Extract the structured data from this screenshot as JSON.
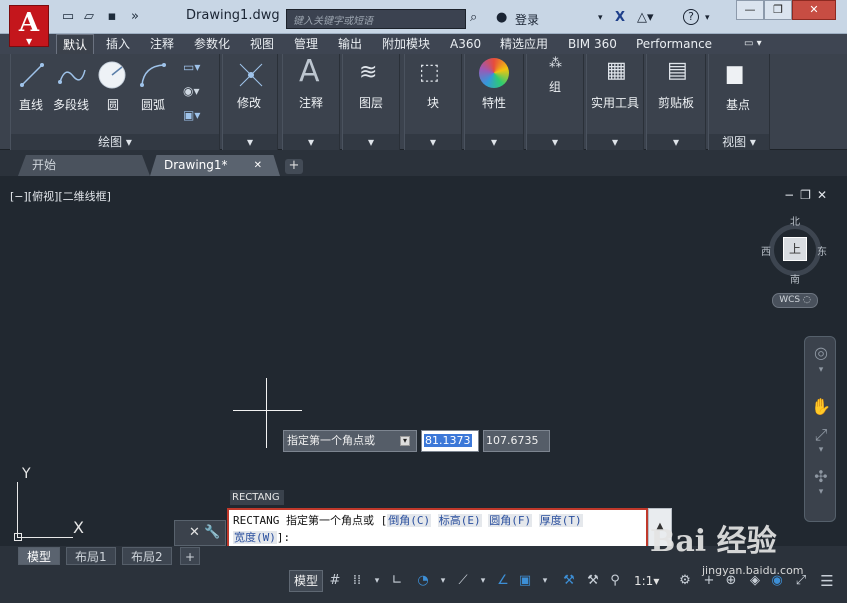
{
  "window": {
    "title": "Drawing1.dwg",
    "search_placeholder": "键入关键字或短语",
    "login_label": "登录",
    "help_label": "?",
    "minimize": "—",
    "restore": "❐",
    "close": "✕"
  },
  "ribbon_tabs": [
    "默认",
    "插入",
    "注释",
    "参数化",
    "视图",
    "管理",
    "输出",
    "附加模块",
    "A360",
    "精选应用",
    "BIM 360",
    "Performance"
  ],
  "ribbon_panels": {
    "draw": {
      "footer": "绘图 ▾",
      "tools": [
        "直线",
        "多段线",
        "圆",
        "圆弧"
      ]
    },
    "modify": {
      "label": "修改"
    },
    "annotate": {
      "label": "注释"
    },
    "layers": {
      "label": "图层"
    },
    "block": {
      "label": "块"
    },
    "properties": {
      "label": "特性"
    },
    "groups": {
      "label": "组"
    },
    "utilities": {
      "label": "实用工具"
    },
    "clipboard": {
      "label": "剪贴板"
    },
    "view": {
      "label": "基点",
      "footer": "视图 ▾"
    }
  },
  "file_tabs": {
    "start": "开始",
    "drawing": "Drawing1*",
    "close": "✕",
    "add": "+"
  },
  "viewport": {
    "label": "[−][俯视][二维线框]",
    "controls": "−❐✕",
    "cube_face": "上",
    "north": "北",
    "south": "南",
    "east": "东",
    "west": "西",
    "wcs": "WCS ◌"
  },
  "dynamic_input": {
    "prompt": "指定第一个角点或",
    "x_value": "81.1373",
    "y_value": "107.6735"
  },
  "ucs": {
    "x": "X",
    "y": "Y"
  },
  "command": {
    "history_label": "RECTANG",
    "line1_prefix": "RECTANG 指定第一个角点或 [",
    "opt_chamfer": "倒角(C)",
    "opt_elevation": "标高(E)",
    "opt_fillet": "圆角(F)",
    "opt_thickness": "厚度(T)",
    "opt_width": "宽度(W)",
    "line2_suffix": "]:",
    "tools": "✕ 🔧",
    "scroll_up": "▲"
  },
  "layout_tabs": [
    "模型",
    "布局1",
    "布局2"
  ],
  "layout_add": "+",
  "status": {
    "model": "模型",
    "scale": "1:1▾"
  },
  "watermark": {
    "logo": "Bai  经验",
    "sub": "jingyan.baidu.com"
  }
}
